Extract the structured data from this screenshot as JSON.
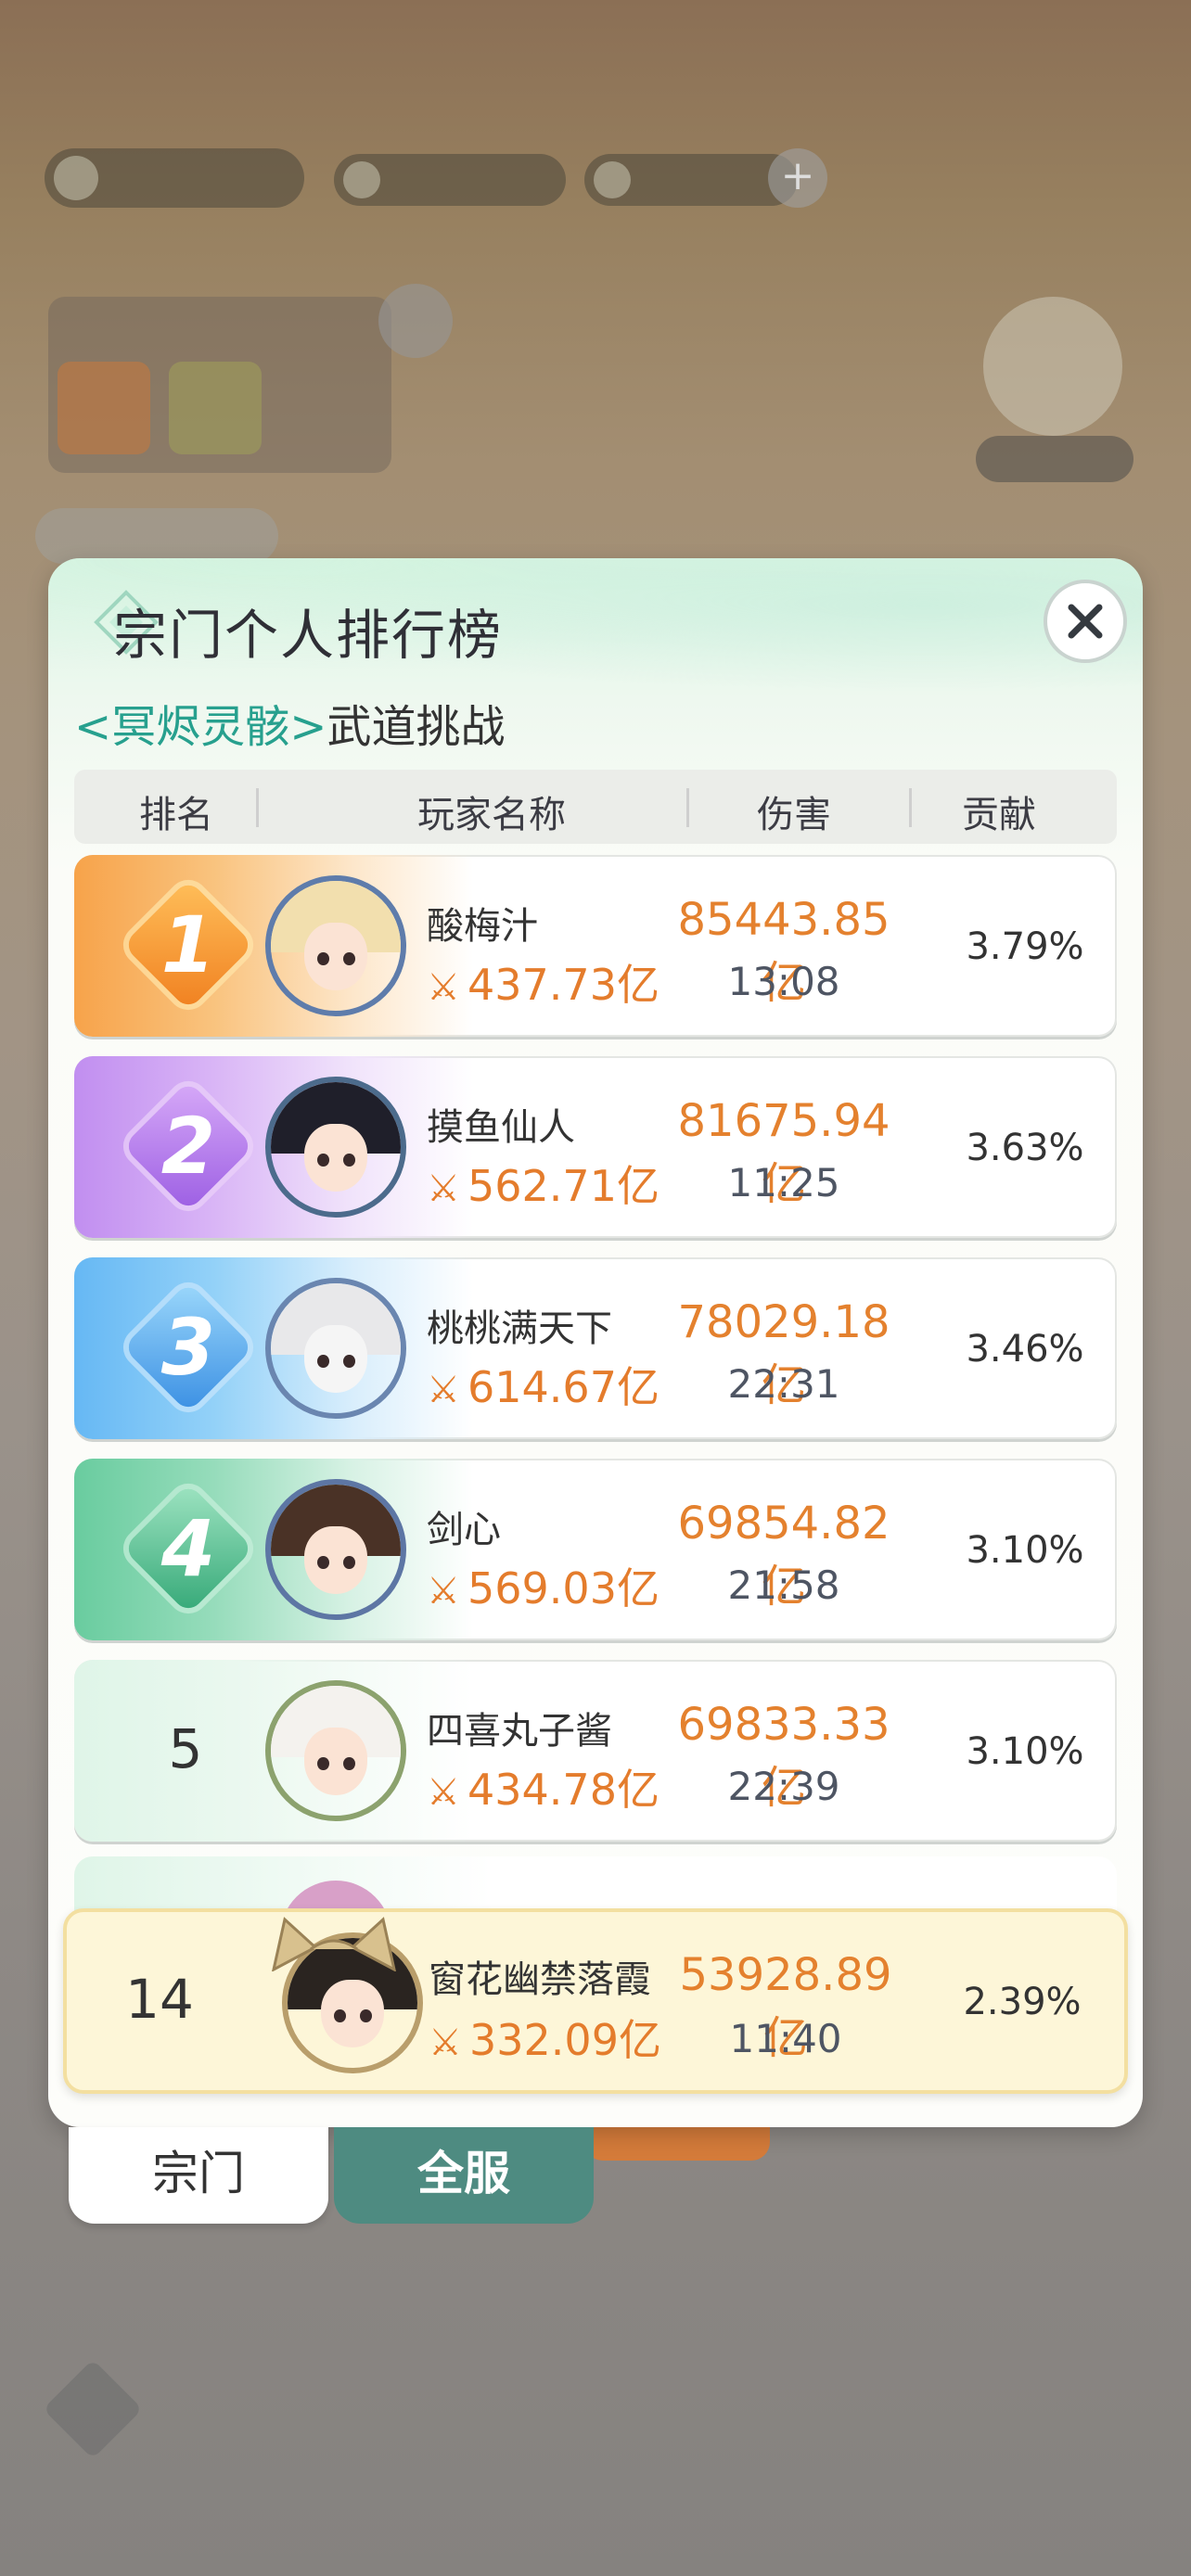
{
  "panel": {
    "title": "宗门个人排行榜",
    "subtitle_highlight": "<冥烬灵骸>",
    "subtitle_rest": "武道挑战",
    "close_icon": "close-icon"
  },
  "table": {
    "headers": {
      "rank": "排名",
      "player": "玩家名称",
      "damage": "伤害",
      "contribution": "贡献"
    },
    "rows": [
      {
        "rank": "1",
        "name": "酸梅汁",
        "power": "437.73亿",
        "damage": "85443.85亿",
        "time": "13:08",
        "contribution": "3.79%"
      },
      {
        "rank": "2",
        "name": "摸鱼仙人",
        "power": "562.71亿",
        "damage": "81675.94亿",
        "time": "11:25",
        "contribution": "3.63%"
      },
      {
        "rank": "3",
        "name": "桃桃满天下",
        "power": "614.67亿",
        "damage": "78029.18亿",
        "time": "22:31",
        "contribution": "3.46%"
      },
      {
        "rank": "4",
        "name": "剑心",
        "power": "569.03亿",
        "damage": "69854.82亿",
        "time": "21:58",
        "contribution": "3.10%"
      },
      {
        "rank": "5",
        "name": "四喜丸子酱",
        "power": "434.78亿",
        "damage": "69833.33亿",
        "time": "22:39",
        "contribution": "3.10%"
      }
    ],
    "self": {
      "rank": "14",
      "name": "窗花幽禁落霞",
      "power": "332.09亿",
      "damage": "53928.89亿",
      "time": "11:40",
      "contribution": "2.39%"
    }
  },
  "tabs": {
    "zongmen": "宗门",
    "quanfu": "全服"
  },
  "colors": {
    "accent": "#27a08e",
    "damage": "#e4812e",
    "tab_active": "#4e8b81"
  }
}
